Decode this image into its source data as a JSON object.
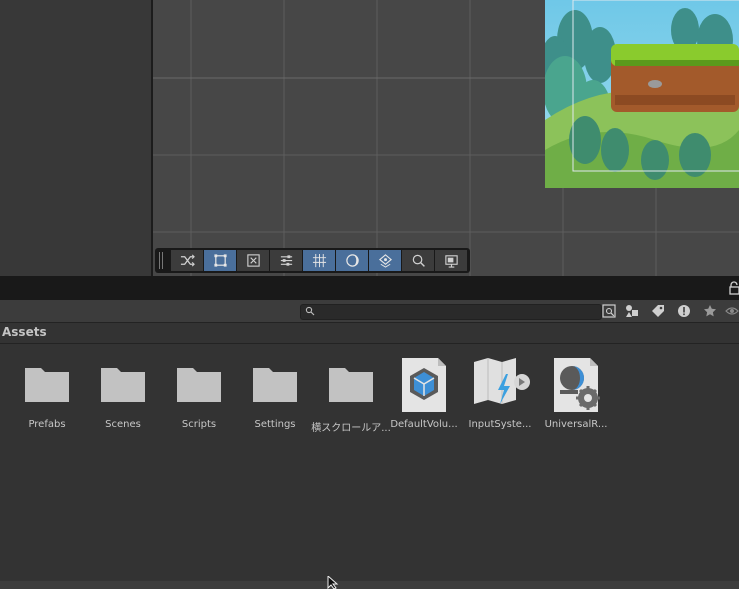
{
  "project": {
    "search": {
      "placeholder": "",
      "value": ""
    },
    "breadcrumb": "Assets",
    "assets": [
      {
        "label": "Prefabs",
        "type": "folder"
      },
      {
        "label": "Scenes",
        "type": "folder"
      },
      {
        "label": "Scripts",
        "type": "folder"
      },
      {
        "label": "Settings",
        "type": "folder"
      },
      {
        "label": "横スクロールア...",
        "type": "folder"
      },
      {
        "label": "DefaultVolu...",
        "type": "volume-profile"
      },
      {
        "label": "InputSyste...",
        "type": "input-actions"
      },
      {
        "label": "UniversalR...",
        "type": "render-pipeline-asset"
      }
    ]
  },
  "scene_toolbar": {
    "tools": [
      "shuffle-icon",
      "rect-select-icon",
      "transform-icon",
      "sliders-icon",
      "grid-snap-icon",
      "shading-icon",
      "gizmo-icon",
      "search-icon",
      "camera-icon"
    ]
  },
  "colors": {
    "panel_bg": "#333333",
    "scene_bg": "#474747",
    "active_tool": "#4a6f9b",
    "folder": "#c2c2c2"
  }
}
